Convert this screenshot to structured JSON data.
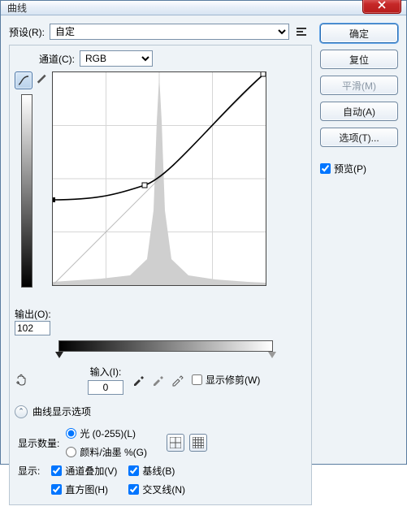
{
  "window": {
    "title": "曲线"
  },
  "preset": {
    "label": "预设(R):",
    "value": "自定"
  },
  "channel": {
    "label": "通道(C):",
    "value": "RGB"
  },
  "output": {
    "label": "输出(O):",
    "value": "102"
  },
  "input": {
    "label": "输入(I):",
    "value": "0"
  },
  "show_clipping": {
    "label": "显示修剪(W)",
    "checked": false
  },
  "display_options": {
    "header": "曲线显示选项",
    "amount_label": "显示数量:",
    "radio_light": "光 (0-255)(L)",
    "radio_pigment": "颜料/油墨 %(G)",
    "selected": "light",
    "show_label": "显示:",
    "channel_overlay": {
      "label": "通道叠加(V)",
      "checked": true
    },
    "histogram": {
      "label": "直方图(H)",
      "checked": true
    },
    "baseline": {
      "label": "基线(B)",
      "checked": true
    },
    "intersection": {
      "label": "交叉线(N)",
      "checked": true
    }
  },
  "buttons": {
    "ok": "确定",
    "reset": "复位",
    "smooth": "平滑(M)",
    "auto": "自动(A)",
    "options": "选项(T)..."
  },
  "preview": {
    "label": "预览(P)",
    "checked": true
  },
  "chart_data": {
    "type": "line",
    "title": "曲线",
    "xlabel": "输入",
    "ylabel": "输出",
    "xlim": [
      0,
      255
    ],
    "ylim": [
      0,
      255
    ],
    "grid": true,
    "series": [
      {
        "name": "curve",
        "x": [
          0,
          110,
          255
        ],
        "y": [
          102,
          120,
          255
        ]
      },
      {
        "name": "baseline",
        "x": [
          0,
          255
        ],
        "y": [
          0,
          255
        ]
      }
    ],
    "histogram_peak_x": 128
  }
}
